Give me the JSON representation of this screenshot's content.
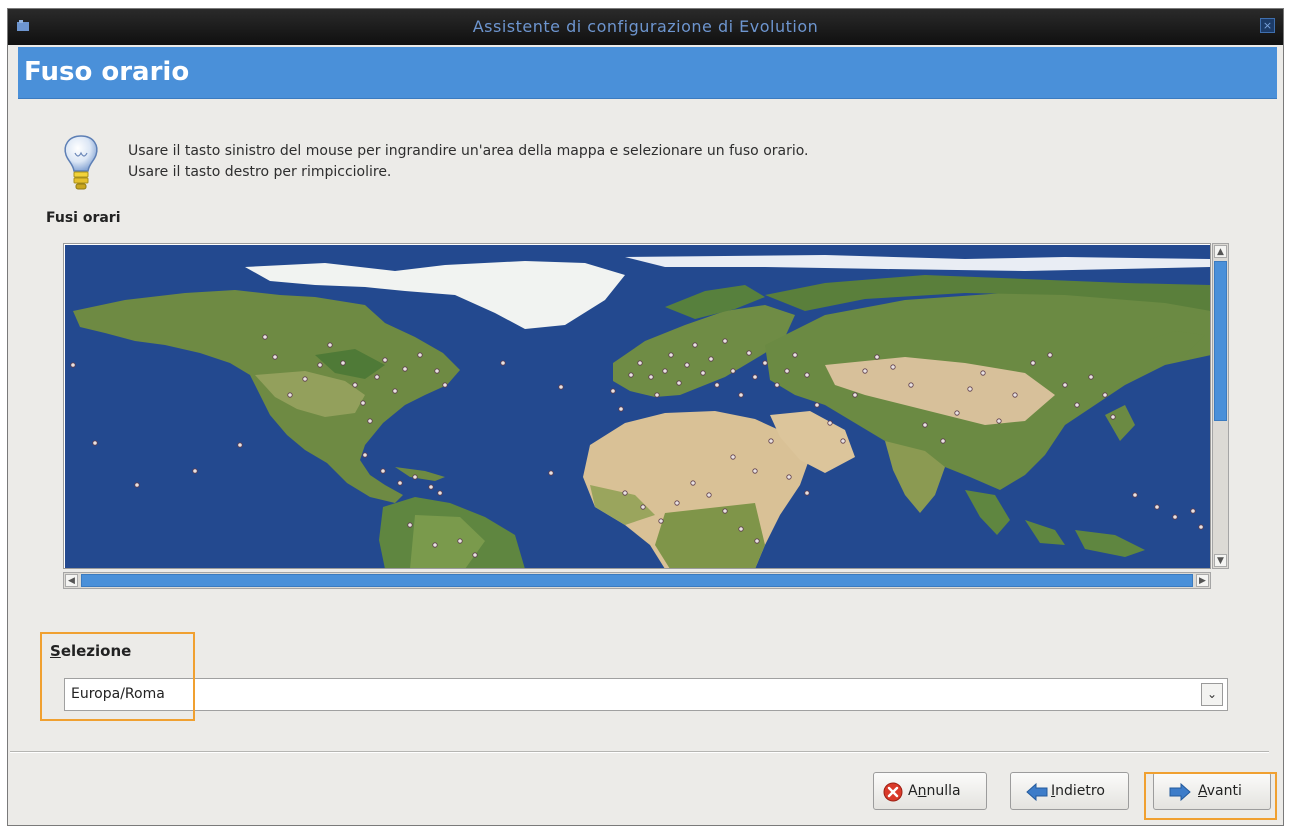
{
  "window": {
    "title": "Assistente di configurazione di Evolution",
    "close_glyph": "×"
  },
  "header": {
    "title": "Fuso orario"
  },
  "info": {
    "icon": "lightbulb-icon",
    "line1": "Usare il tasto sinistro del mouse per ingrandire un'area della mappa e selezionare un fuso orario.",
    "line2": "Usare il tasto destro per rimpicciolire."
  },
  "timezones": {
    "label": "Fusi orari",
    "map": "world-timezone-map"
  },
  "selection": {
    "label_access_key": "S",
    "label_rest": "elezione",
    "value": "Europa/Roma"
  },
  "buttons": {
    "cancel": {
      "pre": "A",
      "access": "n",
      "post": "nulla",
      "icon": "cancel-icon"
    },
    "back": {
      "pre": "",
      "access": "I",
      "post": "ndietro",
      "icon": "arrow-left-icon"
    },
    "next": {
      "pre": "",
      "access": "A",
      "post": "vanti",
      "icon": "arrow-right-icon"
    }
  },
  "colors": {
    "accent": "#4a90d9",
    "highlight": "#f0a030",
    "ocean": "#23498f",
    "cancel_red": "#d93a2a"
  }
}
